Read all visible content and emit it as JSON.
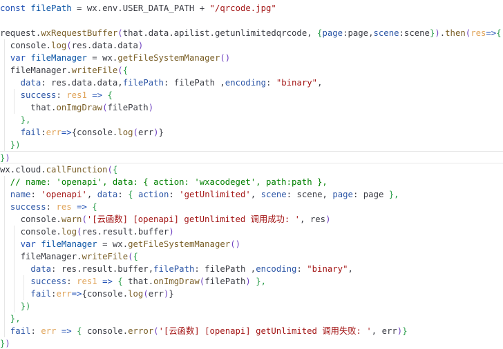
{
  "editor": {
    "colors": {
      "default": "#383a42",
      "keyword": "#1f4fb4",
      "string": "#a31515",
      "function": "#795e26",
      "property": "#2b55a6",
      "variable": "#0a54a5",
      "param": "#e0a45a",
      "comment": "#008000",
      "paren": "#6f42c1",
      "brace_alt": "#2a9d4a",
      "punct": "#383a42"
    },
    "lines": [
      [
        [
          "keyword",
          "const "
        ],
        [
          "variable",
          "filePath"
        ],
        [
          "default",
          " = wx.env.USER_DATA_PATH + "
        ],
        [
          "string",
          "\"/qrcode.jpg\""
        ]
      ],
      [],
      [
        [
          "default",
          "request."
        ],
        [
          "function",
          "wxRequestBuffer"
        ],
        [
          "paren",
          "("
        ],
        [
          "default",
          "that.data.apilist.getunlimitedqrcode, "
        ],
        [
          "brace_alt",
          "{"
        ],
        [
          "property",
          "page"
        ],
        [
          "default",
          ":page,"
        ],
        [
          "property",
          "scene"
        ],
        [
          "default",
          ":scene"
        ],
        [
          "brace_alt",
          "}"
        ],
        [
          "paren",
          ")"
        ],
        [
          "default",
          "."
        ],
        [
          "function",
          "then"
        ],
        [
          "paren",
          "("
        ],
        [
          "param",
          "res"
        ],
        [
          "keyword",
          "=>"
        ],
        [
          "brace_alt",
          "{"
        ]
      ],
      [
        [
          "default",
          "  console."
        ],
        [
          "function",
          "log"
        ],
        [
          "paren",
          "("
        ],
        [
          "default",
          "res.data.data"
        ],
        [
          "paren",
          ")"
        ]
      ],
      [
        [
          "default",
          "  "
        ],
        [
          "keyword",
          "var "
        ],
        [
          "variable",
          "fileManager"
        ],
        [
          "default",
          " = wx."
        ],
        [
          "function",
          "getFileSystemManager"
        ],
        [
          "paren",
          "()"
        ]
      ],
      [
        [
          "default",
          "  fileManager."
        ],
        [
          "function",
          "writeFile"
        ],
        [
          "paren",
          "("
        ],
        [
          "brace_alt",
          "{"
        ]
      ],
      [
        [
          "default",
          "    "
        ],
        [
          "property",
          "data"
        ],
        [
          "default",
          ": res.data.data,"
        ],
        [
          "property",
          "filePath"
        ],
        [
          "default",
          ": filePath ,"
        ],
        [
          "property",
          "encoding"
        ],
        [
          "default",
          ": "
        ],
        [
          "string",
          "\"binary\""
        ],
        [
          "default",
          ","
        ]
      ],
      [
        [
          "default",
          "    "
        ],
        [
          "property",
          "success"
        ],
        [
          "default",
          ": "
        ],
        [
          "param",
          "res1"
        ],
        [
          "default",
          " "
        ],
        [
          "keyword",
          "=>"
        ],
        [
          "default",
          " "
        ],
        [
          "brace_alt",
          "{"
        ]
      ],
      [
        [
          "default",
          "      that."
        ],
        [
          "function",
          "onImgDraw"
        ],
        [
          "paren",
          "("
        ],
        [
          "default",
          "filePath"
        ],
        [
          "paren",
          ")"
        ]
      ],
      [
        [
          "default",
          "    "
        ],
        [
          "brace_alt",
          "},"
        ]
      ],
      [
        [
          "default",
          "    "
        ],
        [
          "property",
          "fail"
        ],
        [
          "default",
          ":"
        ],
        [
          "param",
          "err"
        ],
        [
          "keyword",
          "=>"
        ],
        [
          "default",
          "{console."
        ],
        [
          "function",
          "log"
        ],
        [
          "paren",
          "("
        ],
        [
          "default",
          "err"
        ],
        [
          "paren",
          ")"
        ],
        [
          "default",
          "}"
        ]
      ],
      [
        [
          "default",
          "  "
        ],
        [
          "brace_alt",
          "})"
        ]
      ],
      [
        [
          "brace_alt",
          "}"
        ],
        [
          "paren",
          ")"
        ]
      ],
      [
        [
          "default",
          "wx.cloud."
        ],
        [
          "function",
          "callFunction"
        ],
        [
          "paren",
          "("
        ],
        [
          "brace_alt",
          "{"
        ]
      ],
      [
        [
          "comment",
          "  // name: 'openapi', data: { action: 'wxacodeget', path:path },"
        ]
      ],
      [
        [
          "default",
          "  "
        ],
        [
          "property",
          "name"
        ],
        [
          "default",
          ": "
        ],
        [
          "string",
          "'openapi'"
        ],
        [
          "default",
          ", "
        ],
        [
          "property",
          "data"
        ],
        [
          "default",
          ": "
        ],
        [
          "brace_alt",
          "{"
        ],
        [
          "default",
          " "
        ],
        [
          "property",
          "action"
        ],
        [
          "default",
          ": "
        ],
        [
          "string",
          "'getUnlimited'"
        ],
        [
          "default",
          ", "
        ],
        [
          "property",
          "scene"
        ],
        [
          "default",
          ": scene, "
        ],
        [
          "property",
          "page"
        ],
        [
          "default",
          ": page "
        ],
        [
          "brace_alt",
          "},"
        ]
      ],
      [
        [
          "default",
          "  "
        ],
        [
          "property",
          "success"
        ],
        [
          "default",
          ": "
        ],
        [
          "param",
          "res"
        ],
        [
          "default",
          " "
        ],
        [
          "keyword",
          "=>"
        ],
        [
          "default",
          " "
        ],
        [
          "brace_alt",
          "{"
        ]
      ],
      [
        [
          "default",
          "    console."
        ],
        [
          "function",
          "warn"
        ],
        [
          "paren",
          "("
        ],
        [
          "string",
          "'[云函数] [openapi] getUnlimited 调用成功: '"
        ],
        [
          "default",
          ", res"
        ],
        [
          "paren",
          ")"
        ]
      ],
      [
        [
          "default",
          "    console."
        ],
        [
          "function",
          "log"
        ],
        [
          "paren",
          "("
        ],
        [
          "default",
          "res.result.buffer"
        ],
        [
          "paren",
          ")"
        ]
      ],
      [
        [
          "default",
          "    "
        ],
        [
          "keyword",
          "var "
        ],
        [
          "variable",
          "fileManager"
        ],
        [
          "default",
          " = wx."
        ],
        [
          "function",
          "getFileSystemManager"
        ],
        [
          "paren",
          "()"
        ]
      ],
      [
        [
          "default",
          "    fileManager."
        ],
        [
          "function",
          "writeFile"
        ],
        [
          "paren",
          "("
        ],
        [
          "brace_alt",
          "{"
        ]
      ],
      [
        [
          "default",
          "      "
        ],
        [
          "property",
          "data"
        ],
        [
          "default",
          ": res.result.buffer,"
        ],
        [
          "property",
          "filePath"
        ],
        [
          "default",
          ": filePath ,"
        ],
        [
          "property",
          "encoding"
        ],
        [
          "default",
          ": "
        ],
        [
          "string",
          "\"binary\""
        ],
        [
          "default",
          ","
        ]
      ],
      [
        [
          "default",
          "      "
        ],
        [
          "property",
          "success"
        ],
        [
          "default",
          ": "
        ],
        [
          "param",
          "res1"
        ],
        [
          "default",
          " "
        ],
        [
          "keyword",
          "=>"
        ],
        [
          "default",
          " "
        ],
        [
          "brace_alt",
          "{"
        ],
        [
          "default",
          " that."
        ],
        [
          "function",
          "onImgDraw"
        ],
        [
          "paren",
          "("
        ],
        [
          "default",
          "filePath"
        ],
        [
          "paren",
          ")"
        ],
        [
          "default",
          " "
        ],
        [
          "brace_alt",
          "},"
        ]
      ],
      [
        [
          "default",
          "      "
        ],
        [
          "property",
          "fail"
        ],
        [
          "default",
          ":"
        ],
        [
          "param",
          "err"
        ],
        [
          "keyword",
          "=>"
        ],
        [
          "default",
          "{console."
        ],
        [
          "function",
          "log"
        ],
        [
          "paren",
          "("
        ],
        [
          "default",
          "err"
        ],
        [
          "paren",
          ")"
        ],
        [
          "default",
          "}"
        ]
      ],
      [
        [
          "default",
          "    "
        ],
        [
          "brace_alt",
          "})"
        ]
      ],
      [
        [
          "default",
          "  "
        ],
        [
          "brace_alt",
          "},"
        ]
      ],
      [
        [
          "default",
          "  "
        ],
        [
          "property",
          "fail"
        ],
        [
          "default",
          ": "
        ],
        [
          "param",
          "err"
        ],
        [
          "default",
          " "
        ],
        [
          "keyword",
          "=>"
        ],
        [
          "default",
          " "
        ],
        [
          "brace_alt",
          "{"
        ],
        [
          "default",
          " console."
        ],
        [
          "function",
          "error"
        ],
        [
          "paren",
          "("
        ],
        [
          "string",
          "'[云函数] [openapi] getUnlimited 调用失败: '"
        ],
        [
          "default",
          ", err"
        ],
        [
          "paren",
          ")"
        ],
        [
          "brace_alt",
          "}"
        ]
      ],
      [
        [
          "brace_alt",
          "}"
        ],
        [
          "paren",
          ")"
        ]
      ]
    ]
  }
}
